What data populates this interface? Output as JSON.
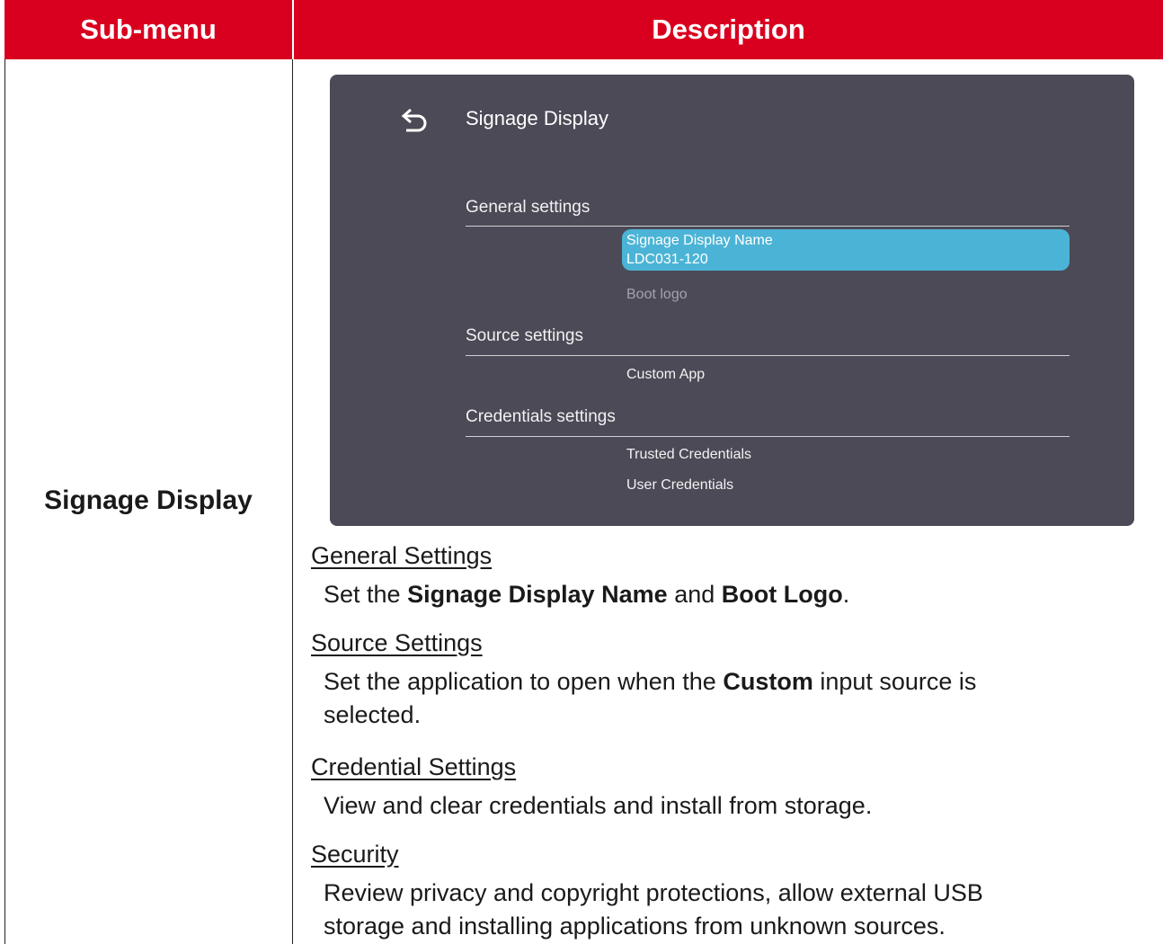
{
  "table": {
    "col1_header": "Sub-menu",
    "col2_header": "Description",
    "row_label": "Signage Display"
  },
  "screen": {
    "title": "Signage Display",
    "sections": [
      {
        "label": "General settings"
      },
      {
        "label": "Source settings"
      },
      {
        "label": "Credentials settings"
      }
    ],
    "items": {
      "display_name_label": "Signage Display Name",
      "display_name_value": "LDC031-120",
      "boot_logo": "Boot logo",
      "custom_app": "Custom App",
      "trusted_credentials": "Trusted Credentials",
      "user_credentials": "User Credentials"
    },
    "colors": {
      "panel": "#4b4a56",
      "highlight": "#4bb4d6"
    }
  },
  "description": {
    "general": {
      "heading": "General Settings",
      "t1": "Set the ",
      "b1": "Signage Display Name",
      "t2": " and ",
      "b2": "Boot Logo",
      "t3": "."
    },
    "source": {
      "heading": "Source Settings",
      "line1_a": "Set the application to open when the ",
      "line1_b": "Custom",
      "line1_c": " input source is",
      "line2": "selected."
    },
    "credential": {
      "heading": "Credential Settings",
      "body": "View and clear credentials and install from storage."
    },
    "security": {
      "heading": "Security",
      "line1": "Review privacy and copyright protections, allow external USB",
      "line2": "storage and installing applications from unknown sources."
    }
  },
  "colors": {
    "header_red": "#d9001f"
  }
}
